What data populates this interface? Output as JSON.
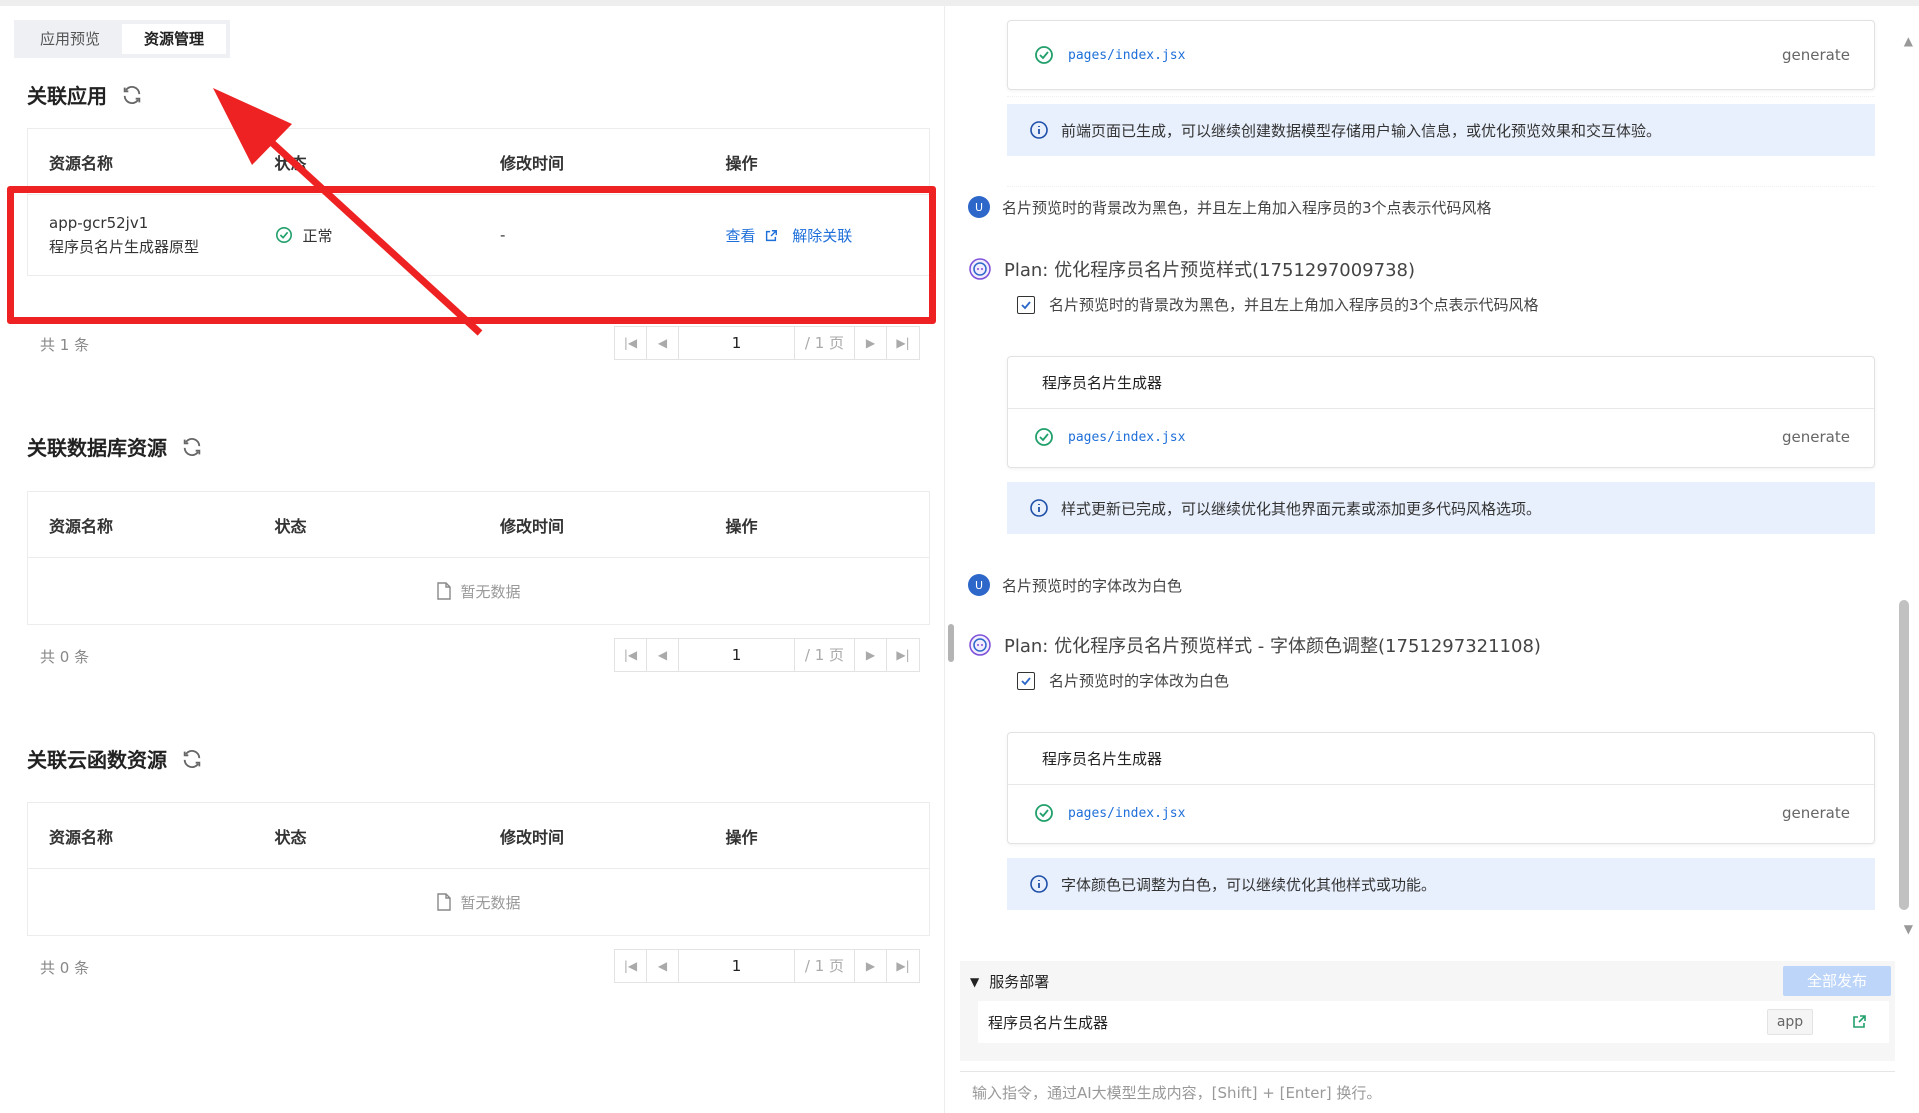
{
  "tabs": [
    "应用预览",
    "资源管理"
  ],
  "sections": {
    "app": {
      "title": "关联应用",
      "columns": [
        "资源名称",
        "状态",
        "修改时间",
        "操作"
      ],
      "row": {
        "name": "app-gcr52jv1",
        "desc": "程序员名片生成器原型",
        "status": "正常",
        "modified": "-",
        "action_view": "查看",
        "action_unlink": "解除关联"
      },
      "total": "共 1 条"
    },
    "db": {
      "title": "关联数据库资源",
      "columns": [
        "资源名称",
        "状态",
        "修改时间",
        "操作"
      ],
      "empty": "暂无数据",
      "total": "共 0 条"
    },
    "func": {
      "title": "关联云函数资源",
      "columns": [
        "资源名称",
        "状态",
        "修改时间",
        "操作"
      ],
      "empty": "暂无数据",
      "total": "共 0 条"
    }
  },
  "pager": {
    "page": "1",
    "of": "/ 1 页"
  },
  "chat": {
    "card0": {
      "file": "pages/index.jsx",
      "action": "generate"
    },
    "info1": "前端页面已生成，可以继续创建数据模型存储用户输入信息，或优化预览效果和交互体验。",
    "msg1": {
      "avatar": "U",
      "text": "名片预览时的背景改为黑色，并且左上角加入程序员的3个点表示代码风格"
    },
    "plan1": {
      "title": "Plan: 优化程序员名片预览样式(1751297009738)",
      "task": "名片预览时的背景改为黑色，并且左上角加入程序员的3个点表示代码风格"
    },
    "card1": {
      "title": "程序员名片生成器",
      "file": "pages/index.jsx",
      "action": "generate"
    },
    "info2": "样式更新已完成，可以继续优化其他界面元素或添加更多代码风格选项。",
    "msg2": {
      "avatar": "U",
      "text": "名片预览时的字体改为白色"
    },
    "plan2": {
      "title": "Plan: 优化程序员名片预览样式 - 字体颜色调整(1751297321108)",
      "task": "名片预览时的字体改为白色"
    },
    "card2": {
      "title": "程序员名片生成器",
      "file": "pages/index.jsx",
      "action": "generate"
    },
    "info3": "字体颜色已调整为白色，可以继续优化其他样式或功能。"
  },
  "deploy": {
    "title": "服务部署",
    "publish": "全部发布",
    "item": "程序员名片生成器",
    "tag": "app"
  },
  "input": {
    "placeholder": "输入指令，通过AI大模型生成内容，[Shift] + [Enter] 换行。"
  },
  "colors": {
    "accent": "#1e6fd9",
    "highlight": "#ee2222",
    "success": "#22a06b",
    "info_bg": "#e8f0fd"
  }
}
